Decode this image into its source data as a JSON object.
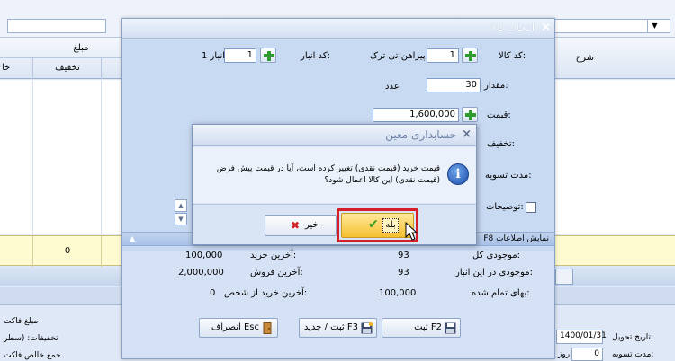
{
  "background": {
    "grid_headers": {
      "mablagh": "مبلغ",
      "takhfif": "تخفیف",
      "kha": "خا",
      "sharh": "شرح"
    },
    "total_row_value": "0",
    "bottom": {
      "mablagh_factor": "مبلغ فاکت",
      "takhfifat": "تخفیفات: (سطر",
      "jam_khales": "جمع خالص فاکت",
      "tarikh_tahvil_label": "تاریخ تحویل:",
      "tarikh_tahvil_value": "1400/01/31",
      "moddat_label": "مدت تسویه:",
      "moddat_value": "0",
      "moddat_unit": "روز"
    }
  },
  "main_dialog": {
    "title": "انتخاب کالا",
    "code_kala_label": "کد کالا:",
    "code_kala_value": "1",
    "kala_name": "پیراهن تی ترک",
    "code_anbar_label": "کد انبار:",
    "code_anbar_value": "1",
    "anbar_name": "انبار 1",
    "meghdar_label": "مقدار:",
    "meghdar_value": "30",
    "meghdar_unit": "عدد",
    "gheymat_label": "قیمت:",
    "gheymat_value": "1,600,000",
    "takhfif_label": "تخفیف:",
    "moddat_label": "مدت تسویه:",
    "tozihat_label": "توضیحات:",
    "f8_text": "F8 نمایش اطلاعات",
    "info": {
      "mojoodi_kol_label": "موجودی کل:",
      "mojoodi_kol_value": "93",
      "mojoodi_anbar_label": "موجودی در این انبار:",
      "mojoodi_anbar_value": "93",
      "baha_label": "بهای تمام شده:",
      "baha_value": "100,000",
      "akharin_kharid_label": "آخرین خرید:",
      "akharin_kharid_value": "100,000",
      "akharin_foroosh_label": "آخرین فروش:",
      "akharin_foroosh_value": "2,000,000",
      "akharin_shakhs_label": "آخرین خرید از شخص:",
      "akharin_shakhs_value": "0"
    },
    "buttons": {
      "sabt": "ثبت F2",
      "sabt_jadid": "ثبت / جدید F3",
      "enseraf": "انصراف Esc"
    }
  },
  "confirm_dialog": {
    "title": "حسابداری معین",
    "message_line1": "قیمت خرید (قیمت نقدی) تغییر کرده است، آیا در قیمت پیش فرض",
    "message_line2": "(قیمت نقدی) این کالا اعمال شود؟",
    "yes_label": "بله",
    "no_label": "خیر"
  }
}
